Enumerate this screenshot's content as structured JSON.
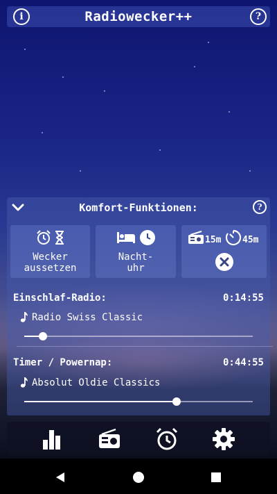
{
  "app": {
    "title": "Radiowecker++"
  },
  "comfort": {
    "title": "Komfort-Funktionen:",
    "tiles": [
      {
        "label_line1": "Wecker",
        "label_line2": "aussetzen"
      },
      {
        "label_line1": "Nacht-",
        "label_line2": "uhr"
      },
      {
        "radio_duration": "15m",
        "timer_duration": "45m"
      }
    ]
  },
  "sleep_radio": {
    "title": "Einschlaf-Radio:",
    "time": "0:14:55",
    "station": "Radio Swiss Classic",
    "slider_fraction": 0.09
  },
  "powernap": {
    "title": "Timer / Powernap:",
    "time": "0:44:55",
    "station": "Absolut Oldie Classics",
    "slider_fraction": 0.67
  },
  "colors": {
    "accent": "#ffffff",
    "panel": "#4a5aa8",
    "navbar": "#0f1223"
  },
  "nav": [
    "statistics-icon",
    "radio-icon",
    "alarm-clock-icon",
    "settings-gear-icon"
  ]
}
